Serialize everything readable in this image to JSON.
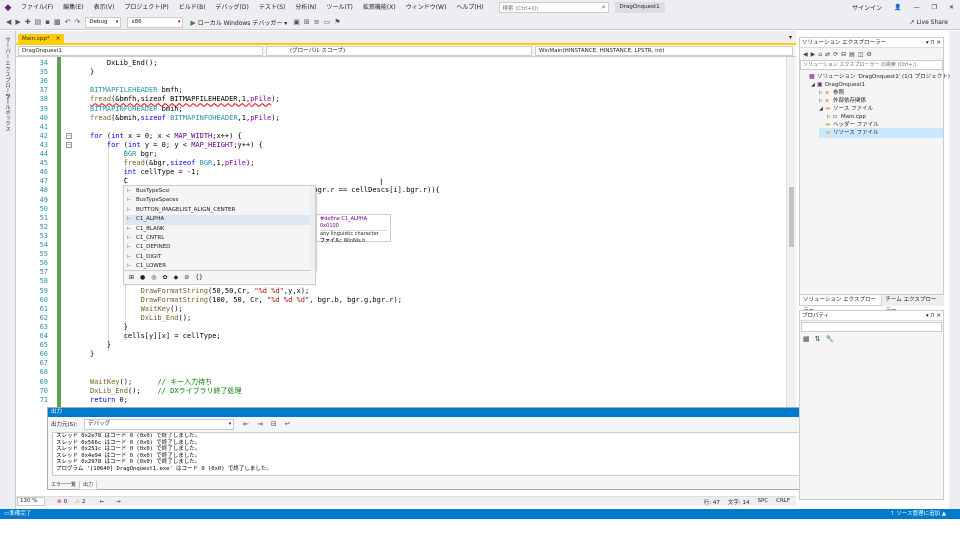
{
  "menubar": {
    "items": [
      "ファイル(F)",
      "編集(E)",
      "表示(V)",
      "プロジェクト(P)",
      "ビルド(B)",
      "デバッグ(D)",
      "テスト(S)",
      "分析(N)",
      "ツール(T)",
      "拡張機能(X)",
      "ウィンドウ(W)",
      "ヘルプ(H)"
    ],
    "search_placeholder": "検索 (Ctrl+Q)",
    "solution_name": "DragOnquest1",
    "signin": "サインイン"
  },
  "toolbar": {
    "config": "Debug",
    "platform": "x86",
    "start_label": "ローカル Windows デバッガー",
    "liveshare": "Live Share"
  },
  "left_strip": {
    "tabs": [
      "サーバー エクスプローラー",
      "ツールボックス"
    ]
  },
  "doc_tab": {
    "name": "Main.cpp*",
    "close": "✕"
  },
  "navbar": {
    "project": "DragOnquest1",
    "scope": "(グローバル スコープ)",
    "function": "WinMain(HINSTANCE, HINSTANCE, LPSTR, int)"
  },
  "editor": {
    "lines": [
      {
        "n": "34",
        "html": "    DxLib_End();",
        "cls": ""
      },
      {
        "n": "35",
        "html": "}",
        "cls": ""
      },
      {
        "n": "36",
        "html": "",
        "cls": ""
      },
      {
        "n": "37",
        "html": "<span class=\"ty\">BITMAPFILEHEADER</span> bmfh;",
        "cls": ""
      },
      {
        "n": "38",
        "html": "<span class=\"fn sq\">fread</span><span class=\"sq\">(&amp;bmfh,sizeof BITMAPFILEHEADER,1,</span><span class=\"pur sq\">pFile</span>);",
        "cls": ""
      },
      {
        "n": "39",
        "html": "<span class=\"ty\">BITMAPINFOHEADER</span> bmih;",
        "cls": ""
      },
      {
        "n": "40",
        "html": "<span class=\"fn\">fread</span>(&amp;bmih,<span class=\"kw\">sizeof</span> <span class=\"ty\">BITMAPINFOHEADER</span>,1,<span class=\"pur\">pFile</span>);",
        "cls": ""
      },
      {
        "n": "41",
        "html": "",
        "cls": ""
      },
      {
        "n": "42",
        "html": "<span class=\"kw\">for</span> (<span class=\"kw\">int</span> x = 0; x &lt; <span class=\"mac\">MAP_WIDTH</span>;x++) {",
        "cls": ""
      },
      {
        "n": "43",
        "html": "    <span class=\"kw\">for</span> (<span class=\"kw\">int</span> y = 0; y &lt; <span class=\"mac\">MAP_HEIGHT</span>;y++) {",
        "cls": ""
      },
      {
        "n": "44",
        "html": "        <span class=\"ty\">BGR</span> bgr;",
        "cls": ""
      },
      {
        "n": "45",
        "html": "        <span class=\"fn\">fread</span>(&amp;bgr,<span class=\"kw\">sizeof</span> <span class=\"ty\">BGR</span>,1,<span class=\"pur\">pFile</span>);",
        "cls": ""
      },
      {
        "n": "46",
        "html": "        <span class=\"kw\">int</span> cellType = -1;",
        "cls": ""
      },
      {
        "n": "47",
        "html": "        C",
        "cls": ""
      },
      {
        "n": "48",
        "html": "                            = cellDescs[i].bgr.g)&amp;&amp; (bgr.r == cellDescs[i].bgr.r)){",
        "cls": ""
      },
      {
        "n": "49",
        "html": "                            55);",
        "cls": ""
      },
      {
        "n": "50",
        "html": "",
        "cls": ""
      },
      {
        "n": "51",
        "html": "                                     bgr.r);",
        "cls": ""
      },
      {
        "n": "52",
        "html": "",
        "cls": ""
      },
      {
        "n": "53",
        "html": "",
        "cls": ""
      },
      {
        "n": "54",
        "html": "",
        "cls": ""
      },
      {
        "n": "55",
        "html": "",
        "cls": ""
      },
      {
        "n": "56",
        "html": "",
        "cls": ""
      },
      {
        "n": "57",
        "html": "",
        "cls": ""
      },
      {
        "n": "58",
        "html": "",
        "cls": ""
      },
      {
        "n": "59",
        "html": "            <span class=\"fn\">DrawFormatString</span>(50,50,Cr, <span class=\"str\">\"%d %d\"</span>,y,x);",
        "cls": ""
      },
      {
        "n": "60",
        "html": "            <span class=\"fn\">DrawFormatString</span>(100, 50, Cr, <span class=\"str\">\"%d %d %d\"</span>, bgr.b, bgr.g,bgr.r);",
        "cls": ""
      },
      {
        "n": "61",
        "html": "            <span class=\"fn\">WaitKey</span>();",
        "cls": ""
      },
      {
        "n": "62",
        "html": "            <span class=\"fn\">DxLib_End</span>();",
        "cls": ""
      },
      {
        "n": "63",
        "html": "        }",
        "cls": ""
      },
      {
        "n": "64",
        "html": "        cells[y][x] = cellType;",
        "cls": ""
      },
      {
        "n": "65",
        "html": "    }",
        "cls": ""
      },
      {
        "n": "66",
        "html": "}",
        "cls": ""
      },
      {
        "n": "67",
        "html": "",
        "cls": ""
      },
      {
        "n": "68",
        "html": "",
        "cls": ""
      },
      {
        "n": "69",
        "html": "<span class=\"fn\">WaitKey</span>();      <span class=\"cmt\">// キー入力待ち</span>",
        "cls": ""
      },
      {
        "n": "70",
        "html": "<span class=\"fn\">DxLib_End</span>();    <span class=\"cmt\">// DXライブラリ終了処理</span>",
        "cls": ""
      },
      {
        "n": "71",
        "html": "<span class=\"kw\">return</span> 0;",
        "cls": ""
      }
    ]
  },
  "completion": {
    "items": [
      "BusTypeScsi",
      "BusTypeSpaces",
      "BUTTON_IMAGELIST_ALIGN_CENTER",
      "C1_ALPHA",
      "C1_BLANK",
      "C1_CNTRL",
      "C1_DEFINED",
      "C1_DIGIT",
      "C1_LOWER"
    ],
    "selected": 3,
    "filter_icons": [
      "⊞",
      "●",
      "◎",
      "✿",
      "◆",
      "⊘",
      "{}"
    ]
  },
  "tooltip": {
    "header": "#define C1_ALPHA 0x0100",
    "desc": "any linguistic character",
    "file_label": "ファイル:",
    "file": "WinNls.h"
  },
  "output": {
    "title": "出力",
    "source_label": "出力元(S):",
    "source_value": "デバッグ",
    "lines": [
      "スレッド 0x2e78 はコード 0 (0x0) で終了しました。",
      "スレッド 0x566c はコード 0 (0x0) で終了しました。",
      "スレッド 0x251c はコード 0 (0x0) で終了しました。",
      "スレッド 0x4e94 はコード 0 (0x0) で終了しました。",
      "スレッド 0x2978 はコード 0 (0x0) で終了しました。",
      "プログラム '[10640] DragOnquest1.exe' はコード 0 (0x0) で終了しました。"
    ],
    "tabs": [
      "エラー一覧",
      "出力"
    ]
  },
  "edstatus": {
    "zoom": "130 %",
    "errors": "0",
    "warnings": "2",
    "line": "行: 47",
    "col": "文字: 14",
    "spc": "SPC",
    "crlf": "CRLF"
  },
  "statusbar": {
    "ready": "準備完了",
    "source_control": "↑ ソース管理に追加 ▲"
  },
  "solexp": {
    "title": "ソリューション エクスプローラー",
    "search": "ソリューション エクスプローラー の検索 (Ctrl+;)",
    "tree": [
      {
        "label": "ソリューション 'DragOnquest1' (1/1 プロジェクト)",
        "depth": 0,
        "caret": "",
        "icon": "▦"
      },
      {
        "label": "DragOnquest1",
        "depth": 1,
        "caret": "◢",
        "icon": "▣"
      },
      {
        "label": "参照",
        "depth": 2,
        "caret": "▷",
        "icon": "▪"
      },
      {
        "label": "外部依存関係",
        "depth": 2,
        "caret": "▷",
        "icon": "▪"
      },
      {
        "label": "ソース ファイル",
        "depth": 2,
        "caret": "◢",
        "icon": "▬"
      },
      {
        "label": "Main.cpp",
        "depth": 3,
        "caret": "▷",
        "icon": "▫"
      },
      {
        "label": "ヘッダー ファイル",
        "depth": 2,
        "caret": "",
        "icon": "▬"
      },
      {
        "label": "リソース ファイル",
        "depth": 2,
        "caret": "",
        "icon": "▬"
      }
    ],
    "tabs": [
      "ソリューション エクスプローラー",
      "チーム エクスプローラー"
    ]
  },
  "props": {
    "title": "プロパティ"
  },
  "colors": {
    "accent": "#007acc",
    "tab": "#ffcc00",
    "brand": "#68217a"
  }
}
